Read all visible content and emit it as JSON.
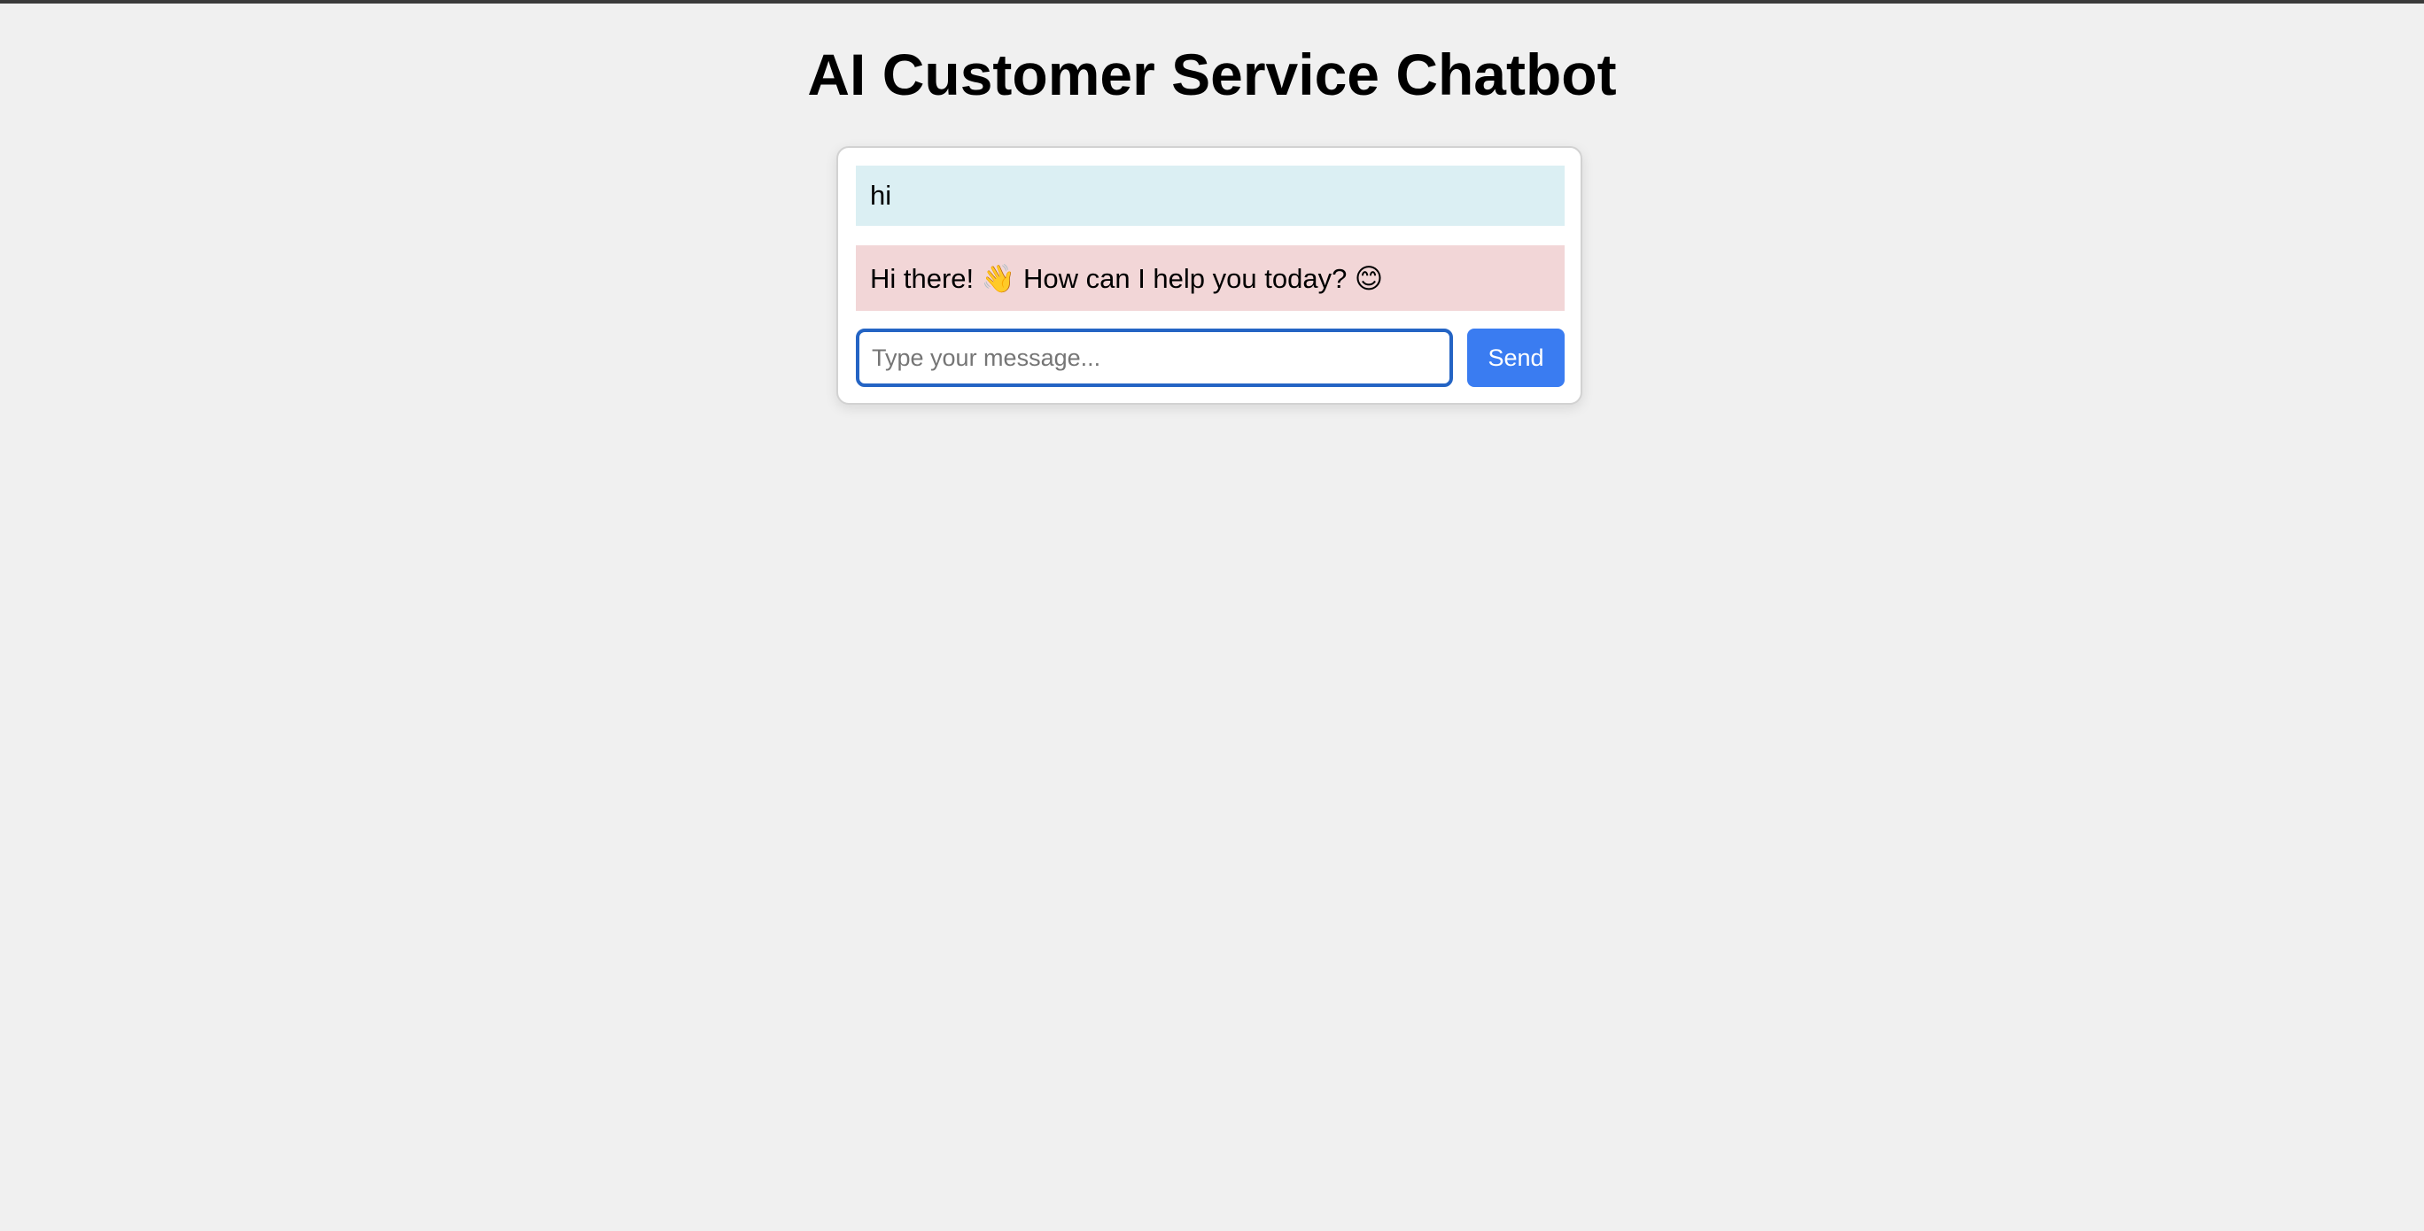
{
  "page": {
    "title": "AI Customer Service Chatbot"
  },
  "chat": {
    "messages": [
      {
        "role": "user",
        "text": "hi"
      },
      {
        "role": "bot",
        "text": "Hi there! 👋 How can I help you today? 😊"
      }
    ],
    "input": {
      "value": "",
      "placeholder": "Type your message..."
    },
    "send_label": "Send"
  },
  "colors": {
    "background": "#f0f0f0",
    "user_bubble": "#dbeff3",
    "bot_bubble": "#f2d6d7",
    "send_button": "#3a7cf1",
    "input_focus_border": "#2464c4"
  }
}
